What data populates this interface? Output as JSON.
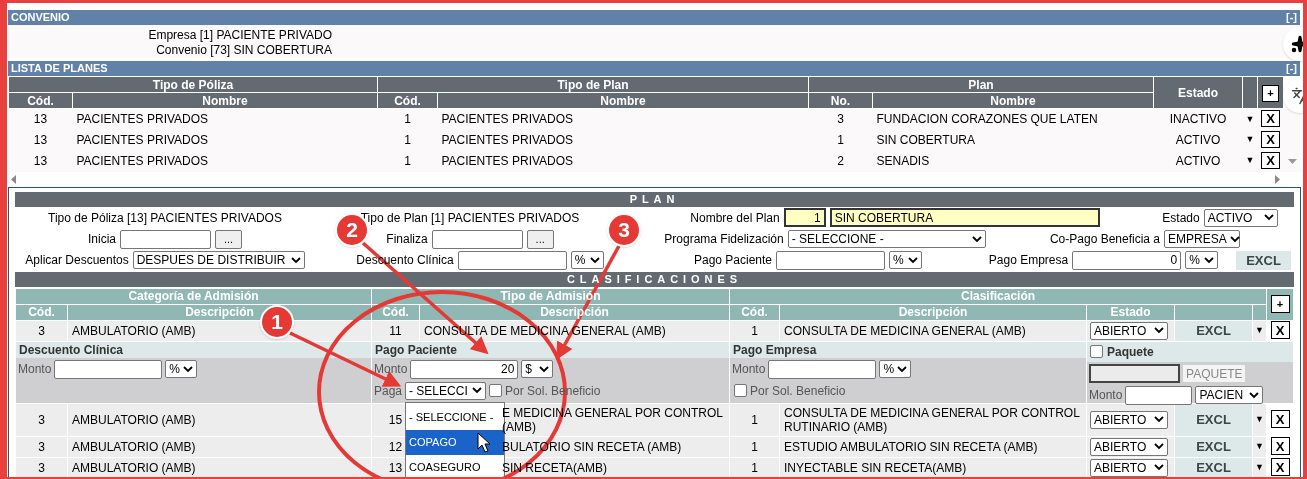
{
  "convenio": {
    "title": "CONVENIO",
    "toggle": "[-]",
    "lines": [
      "Empresa [1] PACIENTE PRIVADO",
      "Convenio [73] SIN COBERTURA"
    ]
  },
  "lista_planes": {
    "title": "LISTA DE PLANES",
    "toggle": "[-]",
    "group_headers": [
      "Tipo de Póliza",
      "Tipo de Plan",
      "Plan"
    ],
    "columns": [
      "Cód.",
      "Nombre",
      "Cód.",
      "Nombre",
      "No.",
      "Nombre"
    ],
    "estado_header": "Estado",
    "add": "+",
    "rows": [
      {
        "cells": [
          "13",
          "PACIENTES PRIVADOS",
          "1",
          "PACIENTES PRIVADOS",
          "3",
          "FUNDACION CORAZONES QUE LATEN"
        ],
        "estado": "INACTIVO",
        "menu": "▼",
        "delete": "X"
      },
      {
        "cells": [
          "13",
          "PACIENTES PRIVADOS",
          "1",
          "PACIENTES PRIVADOS",
          "1",
          "SIN COBERTURA"
        ],
        "estado": "ACTIVO",
        "menu": "▼",
        "delete": "X"
      },
      {
        "cells": [
          "13",
          "PACIENTES PRIVADOS",
          "1",
          "PACIENTES PRIVADOS",
          "2",
          "SENADIS"
        ],
        "estado": "ACTIVO",
        "menu": "▼",
        "delete": "X"
      }
    ]
  },
  "plan": {
    "title": "PLAN",
    "rows": [
      [
        {
          "text": "Tipo de Póliza [13] PACIENTES PRIVADOS"
        },
        {
          "text": "Tipo de Plan [1] PACIENTES PRIVADOS"
        },
        {
          "label": "Nombre del Plan",
          "controls": [
            {
              "kind": "number",
              "value": "1",
              "highlighted": true
            },
            {
              "kind": "input",
              "value": "SIN COBERTURA",
              "highlighted": true
            }
          ]
        },
        {
          "label": "Estado",
          "controls": [
            {
              "kind": "select",
              "value": "ACTIVO"
            }
          ]
        }
      ],
      [
        {
          "label": "Inicia",
          "controls": [
            {
              "kind": "input"
            },
            {
              "kind": "button",
              "value": "..."
            }
          ]
        },
        {
          "label": "Finaliza",
          "controls": [
            {
              "kind": "input"
            },
            {
              "kind": "button",
              "value": "..."
            }
          ]
        },
        {
          "label": "Programa Fidelización",
          "controls": [
            {
              "kind": "select",
              "value": "- SELECCIONE -"
            }
          ]
        },
        {
          "label": "Co-Pago Beneficia a",
          "controls": [
            {
              "kind": "select",
              "value": "EMPRESA"
            }
          ]
        }
      ],
      [
        {
          "label": "Aplicar Descuentos",
          "controls": [
            {
              "kind": "select",
              "value": "DESPUES DE DISTRIBUIR"
            }
          ]
        },
        {
          "label": "Descuento Clínica",
          "controls": [
            {
              "kind": "input"
            },
            {
              "kind": "select",
              "value": "%"
            }
          ]
        },
        {
          "label": "Pago Paciente",
          "controls": [
            {
              "kind": "input"
            },
            {
              "kind": "select",
              "value": "%"
            }
          ]
        },
        {
          "label": "Pago Empresa",
          "controls": [
            {
              "kind": "number",
              "value": "0"
            },
            {
              "kind": "select",
              "value": "%"
            }
          ]
        },
        {
          "controls": [
            {
              "kind": "excl",
              "value": "EXCL"
            }
          ]
        }
      ]
    ]
  },
  "clasificaciones": {
    "title": "CLASIFICACIONES",
    "group_headers": [
      "Categoría de Admisión",
      "Tipo de Admisión",
      "Clasificación"
    ],
    "columns": [
      "Cód.",
      "Descripción",
      "Cód.",
      "Descripción",
      "Cód.",
      "Descripción",
      "Estado"
    ],
    "add": "+",
    "rows": [
      {
        "kind": "row",
        "cells": [
          "3",
          "AMBULATORIO (AMB)",
          "11",
          "CONSULTA DE MEDICINA GENERAL (AMB)",
          "1",
          "CONSULTA DE MEDICINA GENERAL (AMB)"
        ],
        "estado": "ABIERTO",
        "excl": "EXCL",
        "menu": "▼",
        "delete": "X"
      },
      {
        "kind": "detail",
        "panels": [
          {
            "title": "Descuento Clínica",
            "monto_label": "Monto",
            "unit": "%"
          },
          {
            "title": "Pago Paciente",
            "monto_label": "Monto",
            "monto": "20",
            "unit": "$",
            "paga_label": "Paga",
            "paga_value": "- SELECCI",
            "beneficio_label": "Por Sol. Beneficio",
            "beneficio_checked": false,
            "options": [
              {
                "label": "- SELECCIONE -",
                "selected": false
              },
              {
                "label": "COPAGO",
                "selected": true
              },
              {
                "label": "COASEGURO",
                "selected": false
              }
            ]
          },
          {
            "title": "Pago Empresa",
            "monto_label": "Monto",
            "unit": "%",
            "beneficio_label": "Por Sol. Beneficio",
            "beneficio_checked": false
          },
          {
            "title": "Paquete",
            "checked": false,
            "button": "PAQUETE",
            "monto_label": "Monto",
            "unit": "PACIEN"
          }
        ]
      },
      {
        "kind": "row",
        "cells": [
          "3",
          "AMBULATORIO (AMB)",
          "15",
          "E MEDICINA GENERAL POR CONTROL (AMB)",
          "1",
          "CONSULTA DE MEDICINA GENERAL POR CONTROL RUTINARIO (AMB)"
        ],
        "estado": "ABIERTO",
        "excl": "EXCL",
        "menu": "▼",
        "delete": "X"
      },
      {
        "kind": "row",
        "cells": [
          "3",
          "AMBULATORIO (AMB)",
          "12",
          "BULATORIO SIN RECETA (AMB)",
          "1",
          "ESTUDIO AMBULATORIO SIN RECETA (AMB)"
        ],
        "estado": "ABIERTO",
        "excl": "EXCL",
        "menu": "▼",
        "delete": "X"
      },
      {
        "kind": "row",
        "cells": [
          "3",
          "AMBULATORIO (AMB)",
          "13",
          "SIN RECETA(AMB)",
          "1",
          "INYECTABLE SIN RECETA(AMB)"
        ],
        "estado": "ABIERTO",
        "excl": "EXCL",
        "menu": "▼",
        "delete": "X"
      }
    ]
  },
  "annotations": [
    "1",
    "2",
    "3"
  ]
}
